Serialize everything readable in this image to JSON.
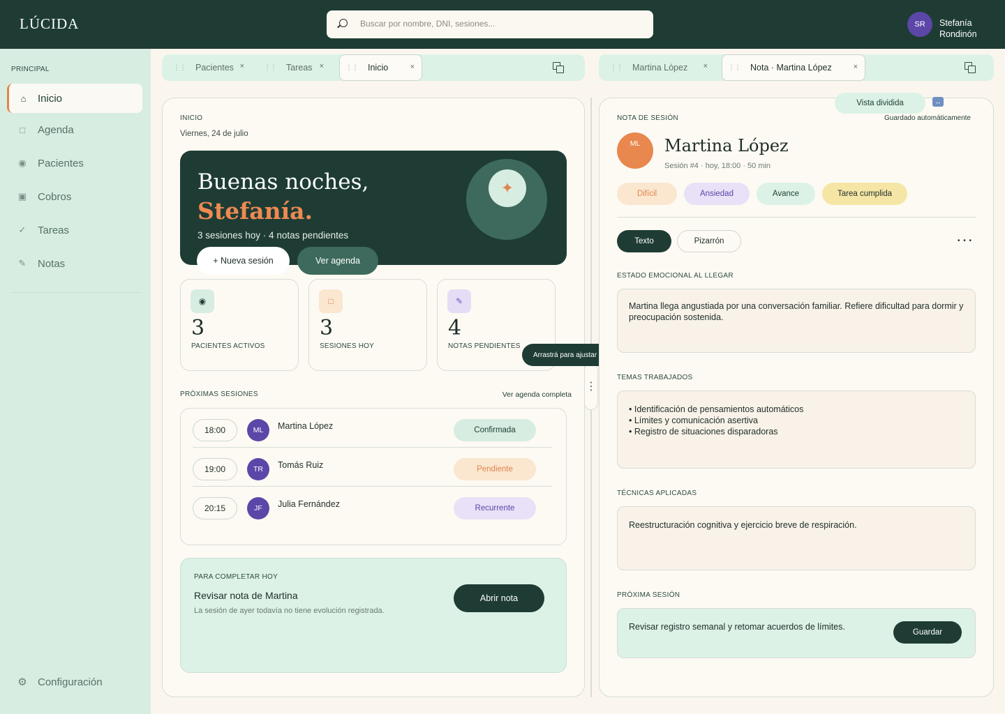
{
  "app": {
    "logo": "LÚCIDA"
  },
  "search": {
    "placeholder": "Buscar por nombre, DNI, sesiones..."
  },
  "user": {
    "initials": "SR",
    "name": "Stefanía Rondinón"
  },
  "sidebar": {
    "heading": "PRINCIPAL",
    "items": [
      {
        "label": "Inicio",
        "icon": "home-icon",
        "glyph": "⌂"
      },
      {
        "label": "Agenda",
        "icon": "calendar-icon",
        "glyph": "□"
      },
      {
        "label": "Pacientes",
        "icon": "patients-icon",
        "glyph": "◉"
      },
      {
        "label": "Cobros",
        "icon": "payments-icon",
        "glyph": "▣"
      },
      {
        "label": "Tareas",
        "icon": "check-icon",
        "glyph": "✓"
      },
      {
        "label": "Notas",
        "icon": "pencil-icon",
        "glyph": "✎"
      }
    ],
    "settings": "Configuración"
  },
  "tabs_left": [
    {
      "label": "Pacientes"
    },
    {
      "label": "Tareas"
    },
    {
      "label": "Inicio",
      "active": true
    }
  ],
  "tabs_right": [
    {
      "label": "Martina López"
    },
    {
      "label": "Nota · Martina López",
      "active": true
    }
  ],
  "home": {
    "section": "INICIO",
    "date": "Viernes, 24 de julio",
    "greeting": "Buenas noches,",
    "name": "Stefanía.",
    "summary": "3 sesiones hoy · 4 notas pendientes",
    "new_session": "+ Nueva sesión",
    "see_agenda": "Ver agenda",
    "stats": [
      {
        "value": "3",
        "label": "PACIENTES ACTIVOS",
        "glyph": "◉",
        "bg": "#d7ede2",
        "fg": "#1e3c34"
      },
      {
        "value": "3",
        "label": "SESIONES HOY",
        "glyph": "□",
        "bg": "#fbe6cf",
        "fg": "#e0854f"
      },
      {
        "value": "4",
        "label": "NOTAS PENDIENTES",
        "glyph": "✎",
        "bg": "#e5dcf5",
        "fg": "#6b55b4"
      }
    ],
    "tooltip": "Arrastrá para ajustar",
    "upcoming_label": "PRÓXIMAS SESIONES",
    "upcoming_link": "Ver agenda completa",
    "sessions": [
      {
        "time": "18:00",
        "initials": "ML",
        "name": "Martina López",
        "status": "Confirmada",
        "bg": "#d7ede2",
        "fg": "#1e3c34"
      },
      {
        "time": "19:00",
        "initials": "TR",
        "name": "Tomás Ruiz",
        "status": "Pendiente",
        "bg": "#fbe6cf",
        "fg": "#e0854f"
      },
      {
        "time": "20:15",
        "initials": "JF",
        "name": "Julia Fernández",
        "status": "Recurrente",
        "bg": "#e8e1f7",
        "fg": "#5c46a8"
      }
    ],
    "todo": {
      "label": "PARA COMPLETAR HOY",
      "title": "Revisar nota de Martina",
      "text": "La sesión de ayer todavía no tiene evolución registrada.",
      "button": "Abrir nota"
    }
  },
  "note": {
    "split_label": "Vista dividida",
    "section": "NOTA DE SESIÓN",
    "autosave": "Guardado automáticamente",
    "initials": "ML",
    "patient": "Martina López",
    "meta": "Sesión #4 · hoy, 18:00 · 50 min",
    "chips": [
      {
        "label": "Difícil",
        "bg": "#fbe6cf",
        "fg": "#e0854f"
      },
      {
        "label": "Ansiedad",
        "bg": "#e8e1f7",
        "fg": "#5c46a8"
      },
      {
        "label": "Avance",
        "bg": "#dcf2e6",
        "fg": "#1e3c34"
      },
      {
        "label": "Tarea cumplida",
        "bg": "#f6e6a6",
        "fg": "#1e2d28"
      }
    ],
    "mode_text": "Texto",
    "mode_board": "Pizarrón",
    "more": "• • •",
    "emotional_label": "ESTADO EMOCIONAL AL LLEGAR",
    "emotional": "Martina llega angustiada por una conversación familiar. Refiere dificultad para dormir y preocupación sostenida.",
    "topics_label": "TEMAS TRABAJADOS",
    "topics": [
      "• Identificación de pensamientos automáticos",
      "• Límites y comunicación asertiva",
      "• Registro de situaciones disparadoras"
    ],
    "techniques_label": "TÉCNICAS APLICADAS",
    "techniques": "Reestructuración cognitiva y ejercicio breve de respiración.",
    "next_label": "PRÓXIMA SESIÓN",
    "next": "Revisar registro semanal y retomar acuerdos de límites.",
    "save": "Guardar"
  },
  "colors": {
    "primary": "#1e3c34",
    "accent": "#e0854f",
    "sidebar": "#d7ede2",
    "avatar": "#5c46a8"
  }
}
